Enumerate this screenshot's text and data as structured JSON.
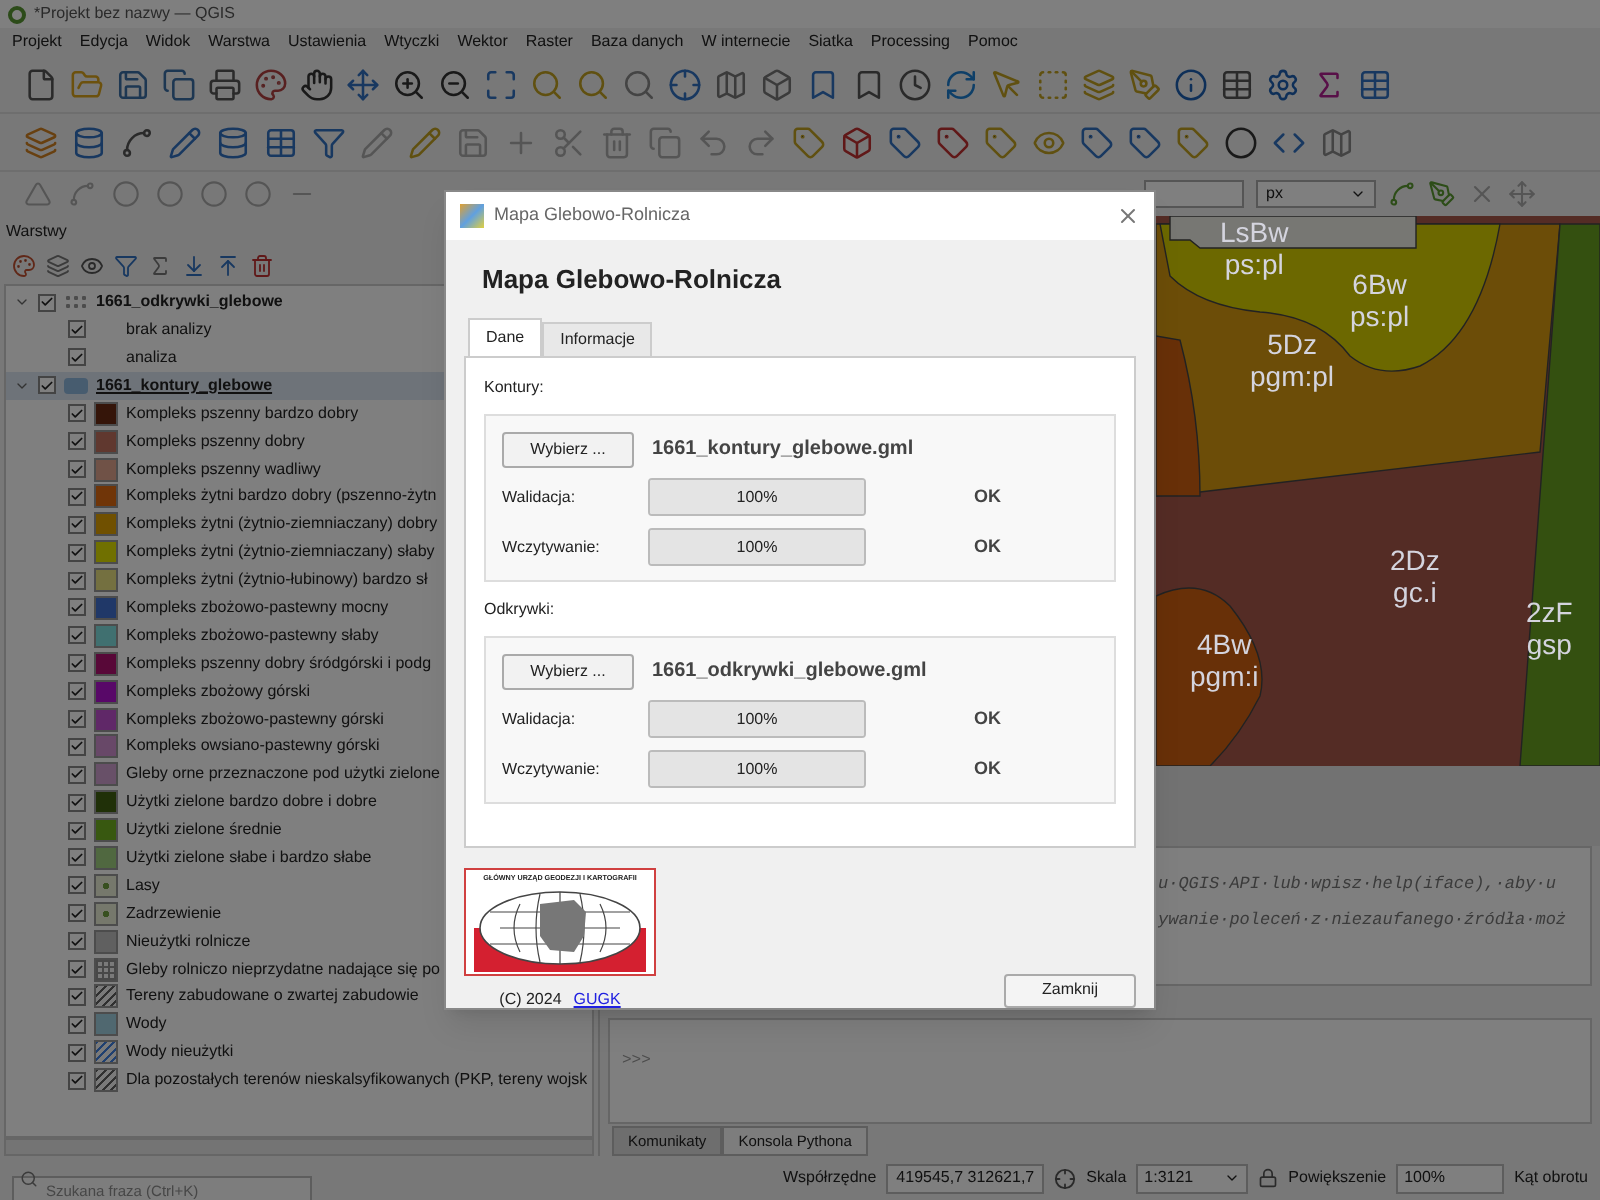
{
  "window": {
    "title": "*Projekt bez nazwy — QGIS"
  },
  "menu": [
    "Projekt",
    "Edycja",
    "Widok",
    "Warstwa",
    "Ustawienia",
    "Wtyczki",
    "Wektor",
    "Raster",
    "Baza danych",
    "W internecie",
    "Siatka",
    "Processing",
    "Pomoc"
  ],
  "toolbar": {
    "unit": "px"
  },
  "layers_panel": {
    "title": "Warstwy",
    "search": {
      "placeholder": "Szukana fraza (Ctrl+K)"
    },
    "layers": [
      {
        "name": "1661_odkrywki_glebowe",
        "kind": "point",
        "checked": true,
        "expanded": true,
        "selected": false,
        "children": [
          {
            "label": "brak analizy",
            "checked": true,
            "kind": "none"
          },
          {
            "label": "analiza",
            "checked": true,
            "kind": "none"
          }
        ]
      },
      {
        "name": "1661_kontury_glebowe",
        "kind": "polygon",
        "checked": true,
        "expanded": true,
        "selected": true,
        "children": [
          {
            "label": "Kompleks pszenny bardzo dobry",
            "checked": true,
            "kind": "fill",
            "color": "#351509"
          },
          {
            "label": "Kompleks pszenny dobry",
            "checked": true,
            "kind": "fill",
            "color": "#60382f"
          },
          {
            "label": "Kompleks pszenny wadliwy",
            "checked": true,
            "kind": "fill",
            "color": "#705247"
          },
          {
            "label": "Kompleks żytni bardzo dobry (pszenno-żytn",
            "checked": true,
            "kind": "fill",
            "color": "#703508"
          },
          {
            "label": "Kompleks żytni (żytnio-ziemniaczany) dobry",
            "checked": true,
            "kind": "fill",
            "color": "#705000"
          },
          {
            "label": "Kompleks żytni (żytnio-ziemniaczany) słaby",
            "checked": true,
            "kind": "fill",
            "color": "#707000"
          },
          {
            "label": "Kompleks żytni (żytnio-łubinowy) bardzo sł",
            "checked": true,
            "kind": "fill",
            "color": "#747040"
          },
          {
            "label": "Kompleks zbożowo-pastewny mocny",
            "checked": true,
            "kind": "fill",
            "color": "#203868"
          },
          {
            "label": "Kompleks zbożowo-pastewny słaby",
            "checked": true,
            "kind": "fill",
            "color": "#407070"
          },
          {
            "label": "Kompleks pszenny dobry śródgórski i podg",
            "checked": true,
            "kind": "fill",
            "color": "#580838"
          },
          {
            "label": "Kompleks zbożowy górski",
            "checked": true,
            "kind": "fill",
            "color": "#580868"
          },
          {
            "label": "Kompleks zbożowo-pastewny górski",
            "checked": true,
            "kind": "fill",
            "color": "#602868"
          },
          {
            "label": "Kompleks owsiano-pastewny górski",
            "checked": true,
            "kind": "fill",
            "color": "#684868"
          },
          {
            "label": "Gleby orne przeznaczone pod użytki zielone",
            "checked": true,
            "kind": "fill",
            "color": "#685068"
          },
          {
            "label": "Użytki zielone bardzo dobre i dobre",
            "checked": true,
            "kind": "fill",
            "color": "#203008"
          },
          {
            "label": "Użytki zielone średnie",
            "checked": true,
            "kind": "fill",
            "color": "#385810"
          },
          {
            "label": "Użytki zielone słabe i bardzo słabe",
            "checked": true,
            "kind": "fill",
            "color": "#506840"
          },
          {
            "label": "Lasy",
            "checked": true,
            "kind": "dots",
            "color": "#76786c"
          },
          {
            "label": "Zadrzewienie",
            "checked": true,
            "kind": "dots",
            "color": "#76786c"
          },
          {
            "label": "Nieużytki rolnicze",
            "checked": true,
            "kind": "fill",
            "color": "#606060"
          },
          {
            "label": "Gleby rolniczo nieprzydatne nadające się po",
            "checked": true,
            "kind": "grid",
            "color": "#484848"
          },
          {
            "label": "Tereny zabudowane o zwartej zabudowie",
            "checked": true,
            "kind": "hatch",
            "color": "#303030"
          },
          {
            "label": "Wody",
            "checked": true,
            "kind": "fill",
            "color": "#506870"
          },
          {
            "label": "Wody nieużytki",
            "checked": true,
            "kind": "hatch",
            "color": "#204070"
          },
          {
            "label": "Dla pozostałych terenów nieskalsyfikowanych (PKP, tereny wojsk",
            "checked": true,
            "kind": "hatch",
            "color": "#303030"
          }
        ]
      }
    ]
  },
  "map": {
    "labels": [
      {
        "code": "LsBw",
        "sub": "ps:pl"
      },
      {
        "code": "6Bw",
        "sub": "ps:pl"
      },
      {
        "code": "5Dz",
        "sub": "pgm:pl"
      },
      {
        "code": "2Dz",
        "sub": "gc.i"
      },
      {
        "code": "4Bw",
        "sub": "pgm:i"
      },
      {
        "code": "2zF",
        "sub": "gsp"
      }
    ]
  },
  "console": {
    "lines": [
      "u·QGIS·API·lub·wpisz·help(iface),·aby·u",
      "ywanie·poleceń·z·niezaufanego·źródła·moż"
    ],
    "prompt": ">>>"
  },
  "bottom_tabs": [
    {
      "label": "Komunikaty",
      "selected": false
    },
    {
      "label": "Konsola Pythona",
      "selected": true
    }
  ],
  "status_bar": {
    "coordinates_label": "Współrzędne",
    "coordinates": "419545,7 312621,7",
    "scale_label": "Skala",
    "scale": "1:3121",
    "magnifier_label": "Powiększenie",
    "magnifier": "100%",
    "rotation_label": "Kąt obrotu"
  },
  "dialog": {
    "title": "Mapa Glebowo-Rolnicza",
    "heading": "Mapa Glebowo-Rolnicza",
    "tabs": [
      {
        "label": "Dane",
        "selected": true
      },
      {
        "label": "Informacje",
        "selected": false
      }
    ],
    "sections": [
      {
        "label": "Kontury:",
        "button": "Wybierz ...",
        "file": "1661_kontury_glebowe.gml",
        "rows": [
          {
            "label": "Walidacja:",
            "level": 1,
            "reading": "100%",
            "status": "OK"
          },
          {
            "label": "Wczytywanie:",
            "level": 1,
            "reading": "100%",
            "status": "OK"
          }
        ]
      },
      {
        "label": "Odkrywki:",
        "button": "Wybierz ...",
        "file": "1661_odkrywki_glebowe.gml",
        "rows": [
          {
            "label": "Walidacja:",
            "level": 1,
            "reading": "100%",
            "status": "OK"
          },
          {
            "label": "Wczytywanie:",
            "level": 1,
            "reading": "100%",
            "status": "OK"
          }
        ]
      }
    ],
    "logo_text": "GŁÓWNY URZĄD GEODEZJI I KARTOGRAFII",
    "copyright": "(C) 2024",
    "link": "GUGK",
    "close_button": "Zamknij"
  }
}
